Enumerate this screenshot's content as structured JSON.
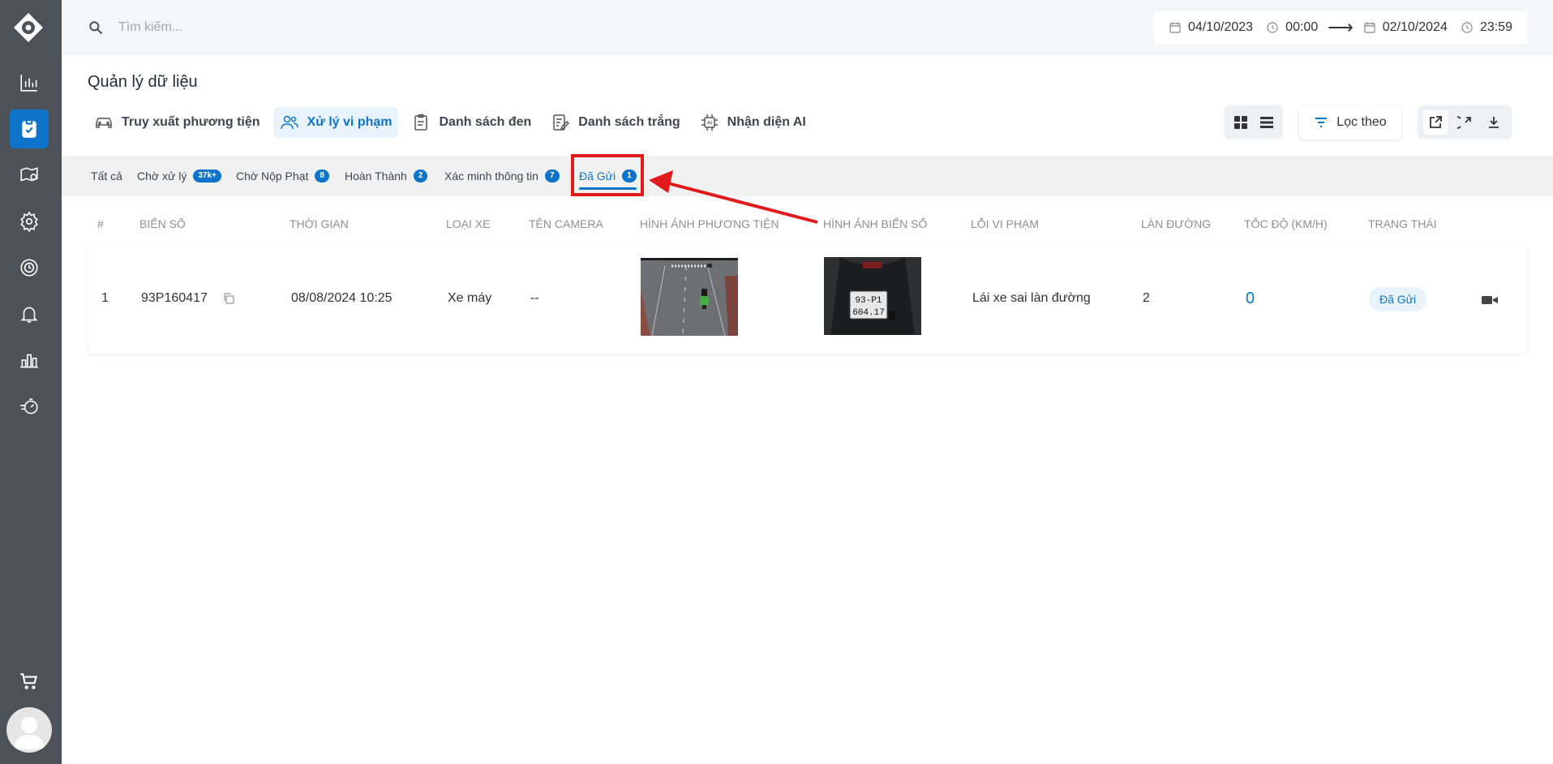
{
  "sidebar": {
    "items": [
      {
        "icon": "chart-icon"
      },
      {
        "icon": "clipboard-check-icon",
        "active": true
      },
      {
        "icon": "map-pin-icon"
      },
      {
        "icon": "gear-icon"
      },
      {
        "icon": "clock-icon"
      },
      {
        "icon": "bell-icon"
      },
      {
        "icon": "bar-chart-icon"
      },
      {
        "icon": "speed-timer-icon"
      }
    ],
    "bottom": [
      {
        "icon": "cart-icon"
      },
      {
        "icon": "avatar"
      }
    ]
  },
  "search": {
    "placeholder": "Tìm kiếm..."
  },
  "date_range": {
    "start_date": "04/10/2023",
    "start_time": "00:00",
    "arrow": "⟶",
    "end_date": "02/10/2024",
    "end_time": "23:59"
  },
  "page": {
    "title": "Quản lý dữ liệu"
  },
  "nav_tabs": [
    {
      "label": "Truy xuất phương tiện",
      "icon": "car-icon"
    },
    {
      "label": "Xử lý vi phạm",
      "icon": "users-icon",
      "active": true
    },
    {
      "label": "Danh sách đen",
      "icon": "clipboard-icon"
    },
    {
      "label": "Danh sách trắng",
      "icon": "edit-list-icon"
    },
    {
      "label": "Nhận diện AI",
      "icon": "ai-chip-icon"
    }
  ],
  "toolbar": {
    "filter_label": "Lọc theo"
  },
  "status_tabs": [
    {
      "label": "Tất cả",
      "badge": null
    },
    {
      "label": "Chờ xử lý",
      "badge": "37k+"
    },
    {
      "label": "Chờ Nộp Phạt",
      "badge": "8"
    },
    {
      "label": "Hoàn Thành",
      "badge": "2"
    },
    {
      "label": "Xác minh thông tin",
      "badge": "7"
    },
    {
      "label": "Đã Gửi",
      "badge": "1",
      "active": true
    }
  ],
  "table": {
    "headers": [
      "#",
      "BIỂN SỐ",
      "THỜI GIAN",
      "LOẠI XE",
      "TÊN CAMERA",
      "HÌNH ẢNH PHƯƠNG TIỆN",
      "HÌNH ẢNH BIỂN SỐ",
      "LỖI VI PHẠM",
      "LÀN ĐƯỜNG",
      "TỐC ĐỘ (KM/H)",
      "TRẠNG THÁI"
    ],
    "rows": [
      {
        "index": "1",
        "plate": "93P160417",
        "time": "08/08/2024 10:25",
        "vehicle_type": "Xe máy",
        "camera": "--",
        "violation": "Lái xe sai làn đường",
        "lane": "2",
        "speed": "0",
        "status": "Đã Gửi",
        "plate_image_text": [
          "93-P1",
          "604.17"
        ]
      }
    ]
  },
  "colors": {
    "accent": "#0d74c9",
    "sidebar": "#4d5259",
    "annotation": "#e11b1b"
  }
}
